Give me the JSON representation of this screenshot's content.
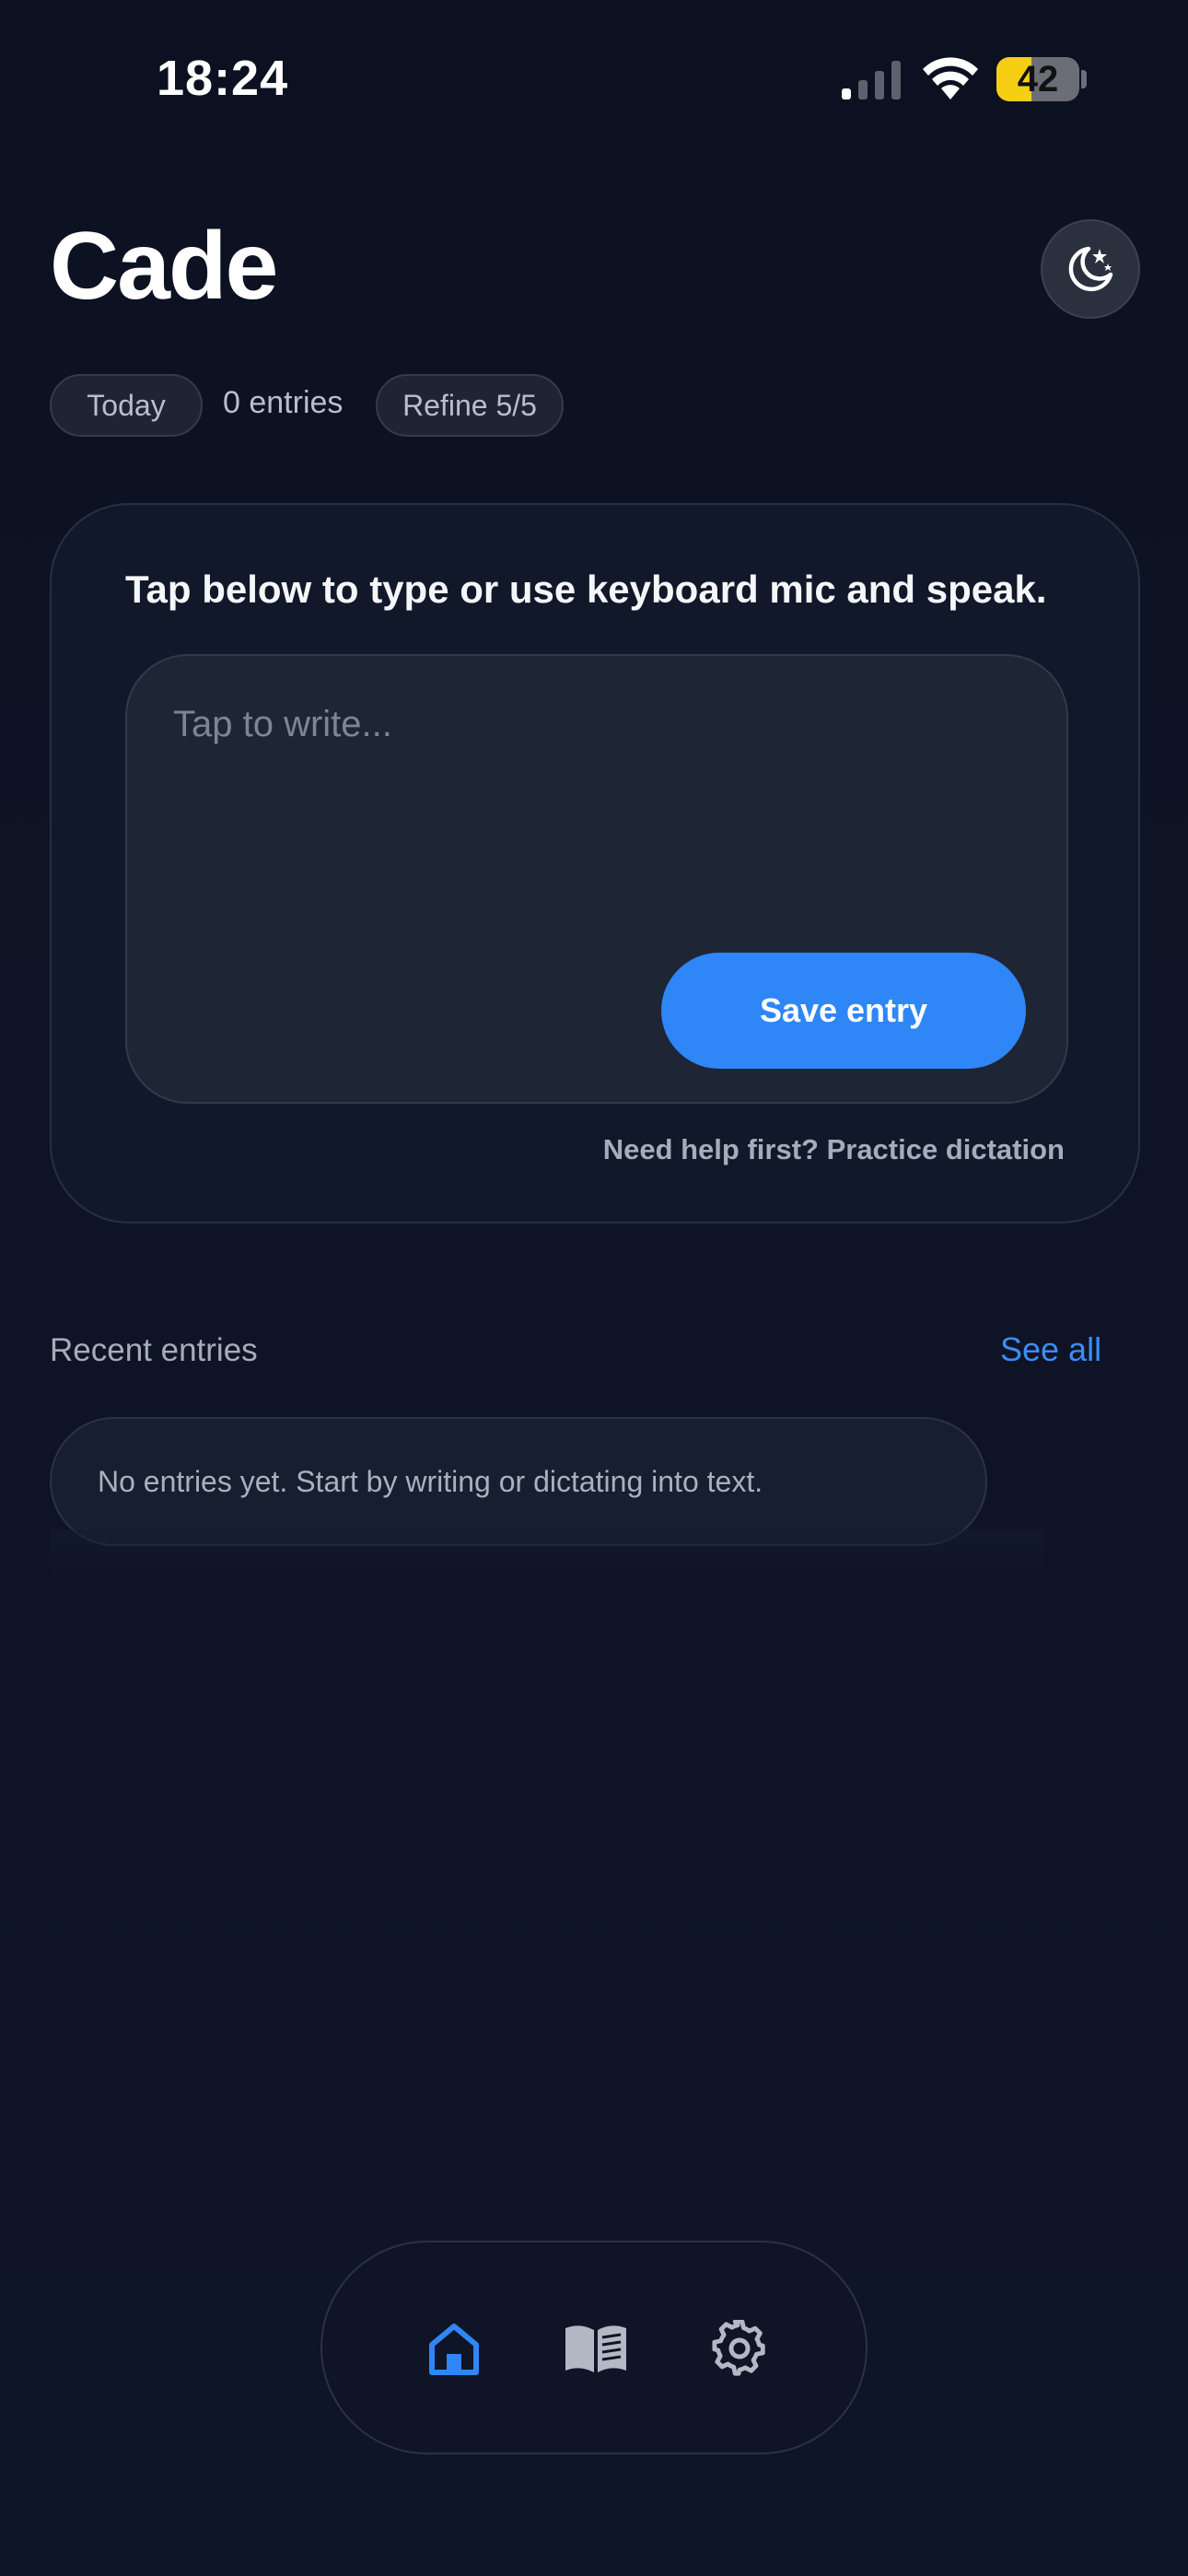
{
  "status_bar": {
    "time": "18:24",
    "battery_level": "42",
    "battery_fraction": 0.42,
    "signal_icon": "cellular-signal-icon",
    "wifi_icon": "wifi-icon"
  },
  "header": {
    "title": "Cade",
    "theme_toggle_icon": "moon-stars-icon"
  },
  "chips": {
    "today": "Today",
    "entries_count": "0 entries",
    "refine": "Refine 5/5"
  },
  "composer": {
    "instructions": "Tap below to type or use keyboard mic and speak.",
    "placeholder": "Tap to write...",
    "save_label": "Save entry",
    "practice_link": "Need help first? Practice dictation"
  },
  "recent": {
    "label": "Recent entries",
    "see_all": "See all",
    "empty_message": "No entries yet. Start by writing or dictating into text."
  },
  "nav": {
    "items": [
      {
        "name": "home",
        "icon": "home-icon",
        "active": true
      },
      {
        "name": "journal",
        "icon": "book-icon",
        "active": false
      },
      {
        "name": "settings",
        "icon": "gear-icon",
        "active": false
      }
    ]
  },
  "colors": {
    "accent": "#2f86f6",
    "background": "#0d1322",
    "battery": "#f6cf15"
  }
}
